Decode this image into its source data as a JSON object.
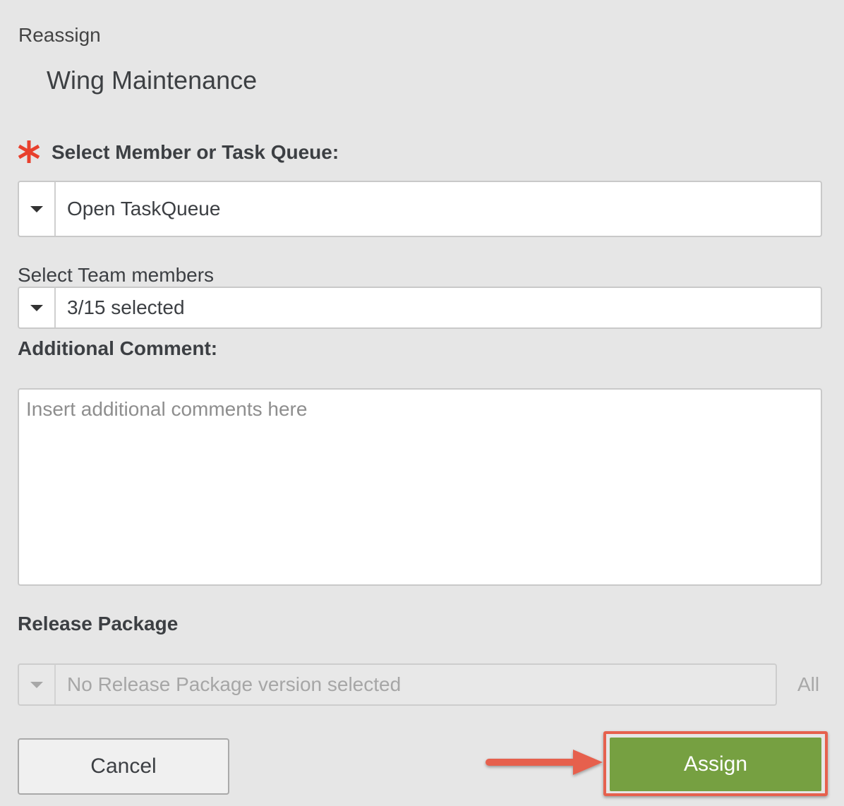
{
  "dialog": {
    "title": "Reassign",
    "item_name": "Wing Maintenance"
  },
  "member_queue": {
    "label": "Select Member or Task Queue:",
    "required": true,
    "selected_value": "Open TaskQueue"
  },
  "team_members": {
    "label": "Select Team members",
    "selected_value": "3/15 selected"
  },
  "comment": {
    "label": "Additional Comment:",
    "placeholder": "Insert additional comments here",
    "value": ""
  },
  "release_package": {
    "label": "Release Package",
    "placeholder": "No Release Package version selected",
    "all_label": "All",
    "disabled": true
  },
  "buttons": {
    "cancel_label": "Cancel",
    "assign_label": "Assign"
  },
  "colors": {
    "background": "#e6e6e6",
    "required_marker": "#e8402d",
    "assign_button": "#76a041",
    "highlight_annotation": "#e6614e"
  },
  "icons": {
    "required": "asterisk-icon",
    "dropdown": "caret-down-icon",
    "annotation": "arrow-right-icon"
  }
}
